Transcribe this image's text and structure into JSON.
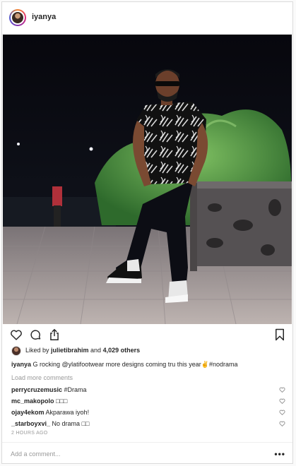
{
  "post": {
    "username": "iyanya",
    "photo_alt": "Photo by iyanya"
  },
  "actions": {
    "like_icon": "heart-outline-icon",
    "comment_icon": "comment-bubble-icon",
    "share_icon": "share-icon",
    "save_icon": "bookmark-icon"
  },
  "likes": {
    "prefix": "Liked by ",
    "first_user": "julietibrahim",
    "middle": " and ",
    "others": "4,029 others"
  },
  "caption": {
    "username": "iyanya",
    "text": " G rocking @ylatifootwear more designs coming tru this year✌#nodrama"
  },
  "load_more": "Load more comments",
  "comments": [
    {
      "username": "perrycruzemusic",
      "text": " #Drama"
    },
    {
      "username": "mc_makopolo",
      "text": " □□□"
    },
    {
      "username": "ojay4ekom",
      "text": " Akparawa iyoh!"
    },
    {
      "username": "_starboyxvi_",
      "text": " No drama □□"
    }
  ],
  "timestamp": "2 HOURS AGO",
  "add_comment": {
    "placeholder": "Add a comment...",
    "more_label": "•••"
  },
  "colors": {
    "text": "#262626",
    "muted": "#999999",
    "border": "#dbdbdb"
  }
}
